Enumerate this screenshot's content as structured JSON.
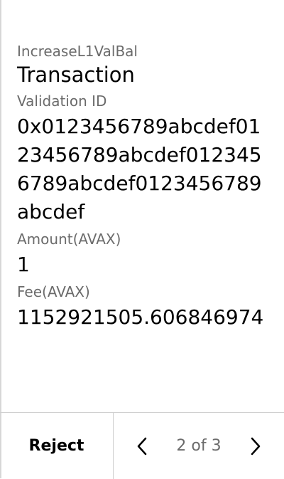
{
  "review": {
    "operation": "IncreaseL1ValBal",
    "title": "Transaction",
    "fields": [
      {
        "label": "Validation ID",
        "value": "0x0123456789abcdef0123456789abcdef0123456789abcdef0123456789abcdef"
      },
      {
        "label": "Amount(AVAX)",
        "value": "1"
      },
      {
        "label": "Fee(AVAX)",
        "value": "1152921505.606846974"
      }
    ]
  },
  "footer": {
    "reject_label": "Reject",
    "page_indicator": "2 of 3",
    "prev_icon": "chevron-left-icon",
    "next_icon": "chevron-right-icon"
  }
}
